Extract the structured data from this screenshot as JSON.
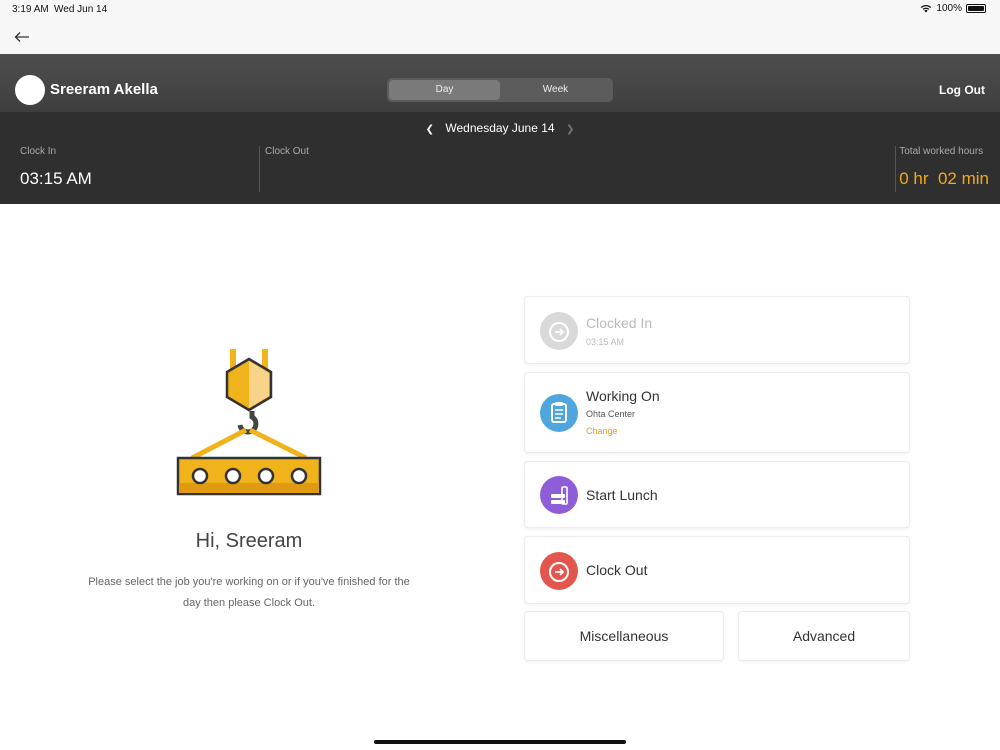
{
  "status": {
    "time": "3:19 AM",
    "date": "Wed Jun 14",
    "battery": "100%"
  },
  "nav": {
    "back_icon": "arrow-left-icon"
  },
  "header": {
    "user_name": "Sreeram Akella",
    "segments": [
      "Day",
      "Week"
    ],
    "selected_segment": "Day",
    "logout_label": "Log Out"
  },
  "summary": {
    "date_label": "Wednesday June 14",
    "clock_in_label": "Clock In",
    "clock_in_value": "03:15 AM",
    "clock_out_label": "Clock Out",
    "clock_out_value": "",
    "total_label": "Total worked hours",
    "total_value": "0 hr  02 min",
    "accent_color": "#f0a91b"
  },
  "main": {
    "greeting": "Hi, Sreeram",
    "description": "Please select the job you're working on or if you've finished for the day then please Clock Out."
  },
  "actions": {
    "clocked_in": {
      "title": "Clocked In",
      "subtitle": "03:15 AM",
      "icon": "arrow-right-circle-icon"
    },
    "working_on": {
      "title": "Working On",
      "subtitle": "Ohta Center",
      "link": "Change",
      "icon": "clipboard-icon"
    },
    "start_lunch": {
      "title": "Start Lunch",
      "icon": "lunch-icon"
    },
    "clock_out": {
      "title": "Clock Out",
      "icon": "clock-out-icon"
    },
    "misc_label": "Miscellaneous",
    "advanced_label": "Advanced"
  }
}
